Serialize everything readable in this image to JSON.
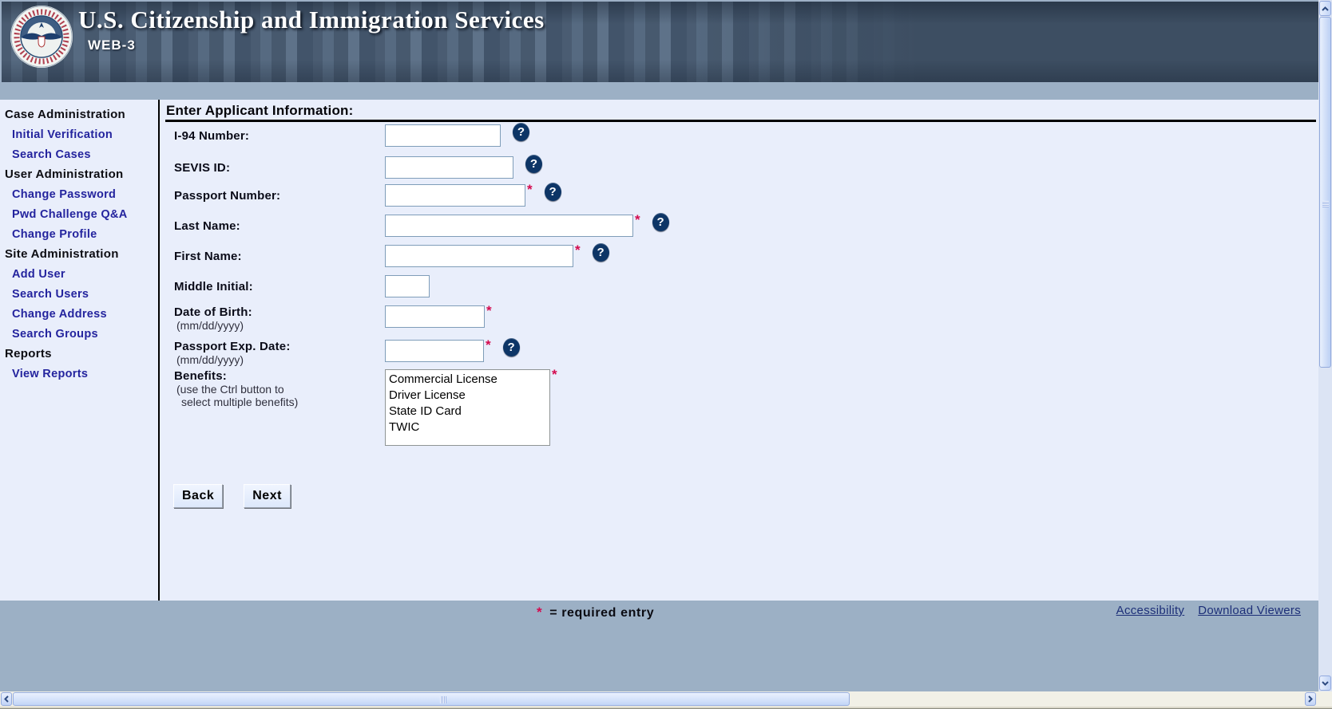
{
  "header": {
    "title": "U.S. Citizenship and Immigration Services",
    "subtitle": "WEB-3"
  },
  "sidebar": {
    "items": [
      {
        "label": "Case Administration",
        "kind": "section"
      },
      {
        "label": "Initial Verification",
        "kind": "link"
      },
      {
        "label": "Search Cases",
        "kind": "link"
      },
      {
        "label": "User Administration",
        "kind": "section"
      },
      {
        "label": "Change Password",
        "kind": "link"
      },
      {
        "label": "Pwd Challenge Q&A",
        "kind": "link"
      },
      {
        "label": "Change Profile",
        "kind": "link"
      },
      {
        "label": "Site Administration",
        "kind": "section"
      },
      {
        "label": "Add User",
        "kind": "link"
      },
      {
        "label": "Search Users",
        "kind": "link"
      },
      {
        "label": "Change Address",
        "kind": "link"
      },
      {
        "label": "Search Groups",
        "kind": "link"
      },
      {
        "label": "Reports",
        "kind": "section"
      },
      {
        "label": "View Reports",
        "kind": "link"
      }
    ]
  },
  "form": {
    "title": "Enter Applicant Information:",
    "required_marker": "*",
    "help_icon": "?",
    "fields": [
      {
        "id": "i94",
        "label": "I-94 Number:",
        "value": "",
        "required": false,
        "help": true
      },
      {
        "id": "sevis",
        "label": "SEVIS ID:",
        "value": "",
        "required": false,
        "help": true
      },
      {
        "id": "passport",
        "label": "Passport Number:",
        "value": "",
        "required": true,
        "help": true
      },
      {
        "id": "last_name",
        "label": "Last Name:",
        "value": "",
        "required": true,
        "help": true
      },
      {
        "id": "first_name",
        "label": "First Name:",
        "value": "",
        "required": true,
        "help": true
      },
      {
        "id": "middle_initial",
        "label": "Middle Initial:",
        "value": "",
        "required": false,
        "help": false
      },
      {
        "id": "dob",
        "label": "Date of Birth:",
        "hint": "(mm/dd/yyyy)",
        "value": "",
        "required": true,
        "help": false
      },
      {
        "id": "passport_exp",
        "label": "Passport Exp. Date:",
        "hint": "(mm/dd/yyyy)",
        "value": "",
        "required": true,
        "help": true
      }
    ],
    "benefits": {
      "label": "Benefits:",
      "hint_line1": "(use the Ctrl button to",
      "hint_line2": "select multiple benefits)",
      "required": true,
      "options": [
        "Commercial License",
        "Driver License",
        "State ID Card",
        "TWIC"
      ]
    },
    "buttons": {
      "back": "Back",
      "next": "Next"
    }
  },
  "footer": {
    "required_note_marker": "*",
    "required_note_text": "= required entry",
    "links": [
      "Accessibility",
      "Download Viewers"
    ]
  },
  "colors": {
    "banner_bg": "#3d4e62",
    "bar_bg": "#9cb0c5",
    "page_bg": "#e9eefb",
    "sidebar_link": "#24249e",
    "required_red": "#d40a4e",
    "help_icon_bg": "#0d3566",
    "input_border": "#7f9db9",
    "footer_link": "#1d2f78"
  }
}
